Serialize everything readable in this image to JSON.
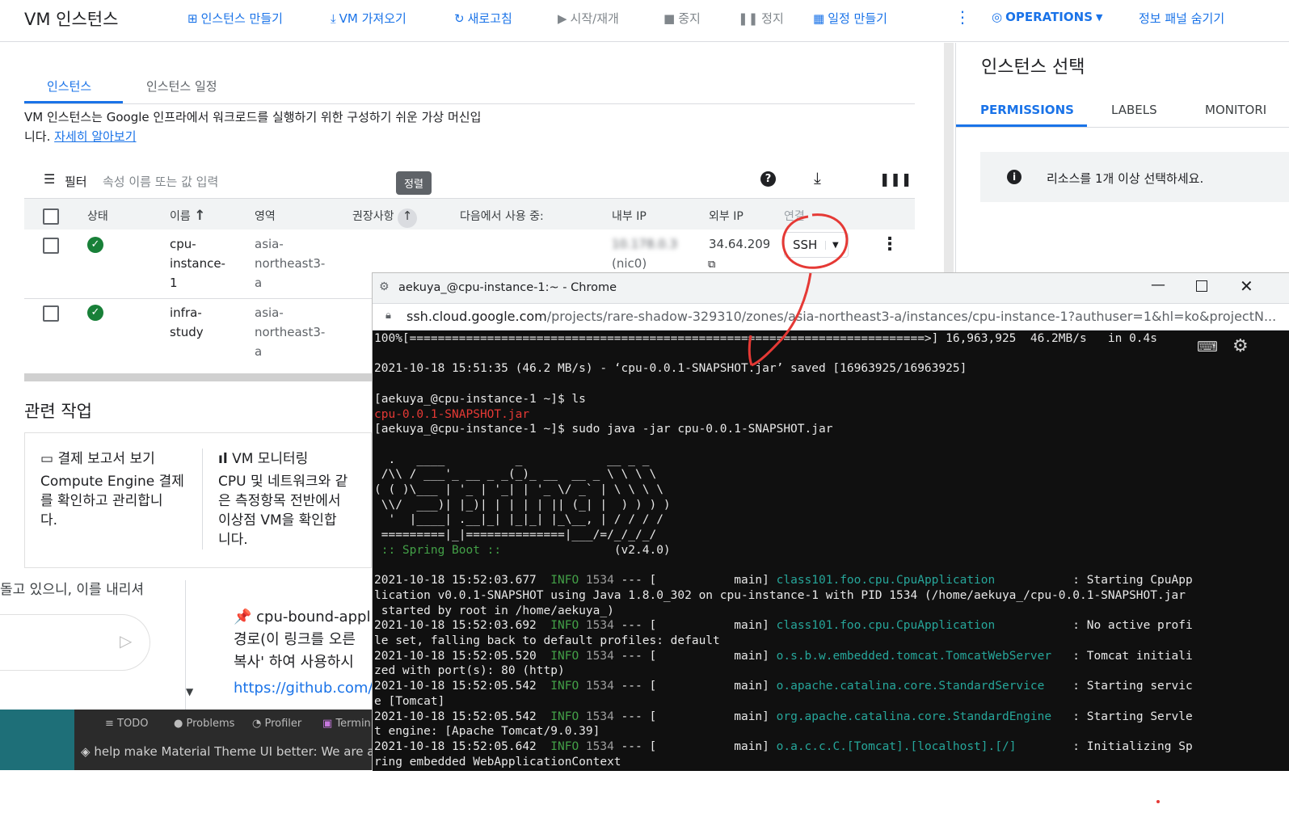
{
  "topbar": {
    "title": "VM 인스턴스",
    "buttons": [
      {
        "label": "인스턴스 만들기",
        "icon": "plus-box-icon"
      },
      {
        "label": "VM 가져오기",
        "icon": "download-icon"
      },
      {
        "label": "새로고침",
        "icon": "refresh-icon"
      },
      {
        "label": "시작/재개",
        "icon": "play-icon"
      },
      {
        "label": "중지",
        "icon": "stop-icon"
      },
      {
        "label": "정지",
        "icon": "pause-icon"
      },
      {
        "label": "일정 만들기",
        "icon": "calendar-icon"
      }
    ],
    "operations": "OPERATIONS",
    "hide_panel": "정보 패널 숨기기"
  },
  "main": {
    "tabs": [
      "인스턴스",
      "인스턴스 일정"
    ],
    "description": "VM 인스턴스는 Google 인프라에서 워크로드를 실행하기 위한 구성하기 쉬운 가상 머신입",
    "description2": "니다.",
    "learn_more": "자세히 알아보기",
    "filter_label": "필터",
    "filter_placeholder": "속성 이름 또는 값 입력",
    "sort_tooltip": "정렬",
    "columns": [
      "상태",
      "이름",
      "영역",
      "권장사항",
      "다음에서 사용 중:",
      "내부 IP",
      "외부 IP",
      "연결"
    ],
    "rows": [
      {
        "name": [
          "cpu-",
          "instance-",
          "1"
        ],
        "zone": [
          "asia-",
          "northeast3-",
          "a"
        ],
        "internal_ip": [
          "10.178.0.3",
          "(nic0)"
        ],
        "external_ip": "34.64.209.",
        "connect": "SSH"
      },
      {
        "name": [
          "infra-",
          "study"
        ],
        "zone": [
          "asia-",
          "northeast3-",
          "a"
        ]
      }
    ],
    "related_title": "관련 작업",
    "cards": [
      {
        "title": "결제 보고서 보기",
        "body": [
          "Compute Engine 결제",
          "를 확인하고 관리합니",
          "다."
        ]
      },
      {
        "title": "VM 모니터링",
        "body": [
          "CPU 및 네트워크와 같",
          "은 측정항목 전반에서",
          "이상점 VM을 확인합",
          "니다."
        ]
      }
    ]
  },
  "right_panel": {
    "title": "인스턴스 선택",
    "tabs": [
      "PERMISSIONS",
      "LABELS",
      "MONITORI"
    ],
    "info": "리소스를 1개 이상 선택하세요."
  },
  "background": {
    "text1": "돌고 있으니, 이를 내리셔",
    "post_title": "cpu-bound-appli",
    "post_line2": "경로(이 링크를 오른",
    "post_line3": "복사' 하여 사용하시",
    "post_link": "https://github.com/ll",
    "ide_tabs": [
      "TODO",
      "Problems",
      "Profiler",
      "Termin"
    ],
    "ide_notice": "help make Material Theme UI better: We are askir"
  },
  "terminal_window": {
    "title": "aekuya_@cpu-instance-1:~ - Chrome",
    "url_host": "ssh.cloud.google.com",
    "url_path": "/projects/rare-shadow-329310/zones/asia-northeast3-a/instances/cpu-instance-1?authuser=1&hl=ko&projectN...",
    "lines": [
      "100%[=========================================================================>] 16,963,925  46.2MB/s   in 0.4s",
      "",
      "2021-10-18 15:51:35 (46.2 MB/s) - ‘cpu-0.0.1-SNAPSHOT.jar’ saved [16963925/16963925]",
      "",
      "[aekuya_@cpu-instance-1 ~]$ ls",
      "cpu-0.0.1-SNAPSHOT.jar",
      "[aekuya_@cpu-instance-1 ~]$ sudo java -jar cpu-0.0.1-SNAPSHOT.jar",
      "",
      "  .   ____          _            __ _ _",
      " /\\\\ / ___'_ __ _ _(_)_ __  __ _ \\ \\ \\ \\",
      "( ( )\\___ | '_ | '_| | '_ \\/ _` | \\ \\ \\ \\",
      " \\\\/  ___)| |_)| | | | | || (_| |  ) ) ) )",
      "  '  |____| .__|_| |_|_| |_\\__, | / / / /",
      " =========|_|==============|___/=/_/_/_/",
      " :: Spring Boot ::                (v2.4.0)",
      ""
    ],
    "logs": [
      {
        "ts": "2021-10-18 15:52:03.677",
        "lvl": "INFO",
        "pid": "1534",
        "cls": "class101.foo.cpu.CpuApplication         ",
        "msg": "  : Starting CpuApp",
        "cont": [
          "lication v0.0.1-SNAPSHOT using Java 1.8.0_302 on cpu-instance-1 with PID 1534 (/home/aekuya_/cpu-0.0.1-SNAPSHOT.jar",
          " started by root in /home/aekuya_)"
        ]
      },
      {
        "ts": "2021-10-18 15:52:03.692",
        "lvl": "INFO",
        "pid": "1534",
        "cls": "class101.foo.cpu.CpuApplication         ",
        "msg": "  : No active profi",
        "cont": [
          "le set, falling back to default profiles: default"
        ]
      },
      {
        "ts": "2021-10-18 15:52:05.520",
        "lvl": "INFO",
        "pid": "1534",
        "cls": "o.s.b.w.embedded.tomcat.TomcatWebServer ",
        "msg": "  : Tomcat initiali",
        "cont": [
          "zed with port(s): 80 (http)"
        ]
      },
      {
        "ts": "2021-10-18 15:52:05.542",
        "lvl": "INFO",
        "pid": "1534",
        "cls": "o.apache.catalina.core.StandardService  ",
        "msg": "  : Starting servic",
        "cont": [
          "e [Tomcat]"
        ]
      },
      {
        "ts": "2021-10-18 15:52:05.542",
        "lvl": "INFO",
        "pid": "1534",
        "cls": "org.apache.catalina.core.StandardEngine ",
        "msg": "  : Starting Servle",
        "cont": [
          "t engine: [Apache Tomcat/9.0.39]"
        ]
      },
      {
        "ts": "2021-10-18 15:52:05.642",
        "lvl": "INFO",
        "pid": "1534",
        "cls": "o.a.c.c.C.[Tomcat].[localhost].[/]      ",
        "msg": "  : Initializing Sp",
        "cont": [
          "ring embedded WebApplicationContext"
        ]
      }
    ]
  },
  "colors": {
    "accent": "#1a73e8",
    "ok": "#188038",
    "annotation": "#e53935"
  }
}
